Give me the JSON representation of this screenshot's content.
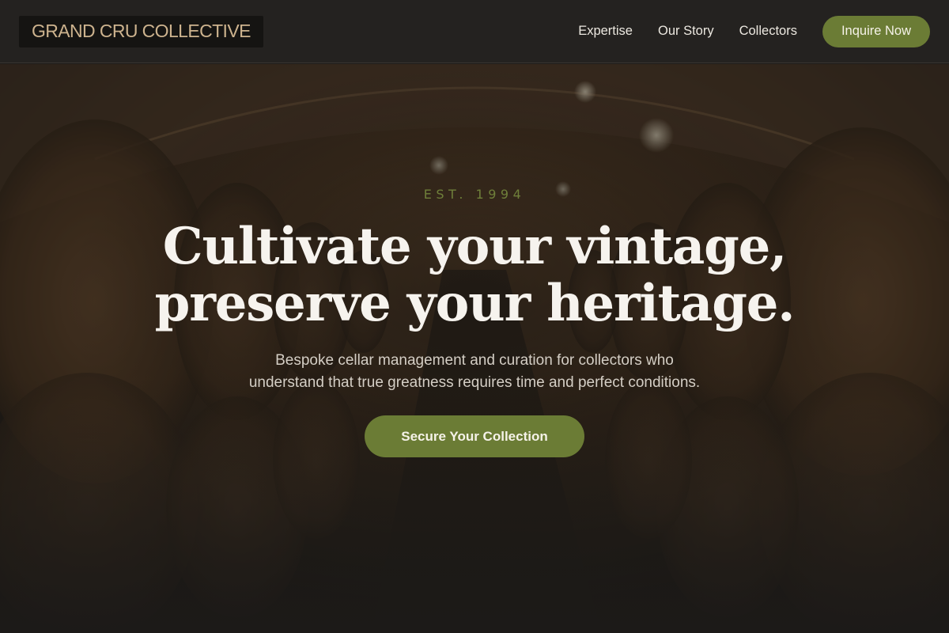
{
  "header": {
    "logo": "GRAND CRU COLLECTIVE",
    "nav": [
      "Expertise",
      "Our Story",
      "Collectors"
    ],
    "cta_label": "Inquire Now"
  },
  "hero": {
    "eyebrow": "EST. 1994",
    "headline_line1": "Cultivate your vintage,",
    "headline_line2": "preserve your heritage.",
    "subtext_line1": "Bespoke cellar management and curation for collectors who",
    "subtext_line2": "understand that true greatness requires time and perfect conditions.",
    "cta_label": "Secure Your Collection",
    "background": "wine-cellar-barrels-photo"
  },
  "colors": {
    "accent": "#6b7c35",
    "logo_text": "#cdb38e",
    "header_bg": "#242220",
    "eyebrow": "#6f7f3a"
  }
}
